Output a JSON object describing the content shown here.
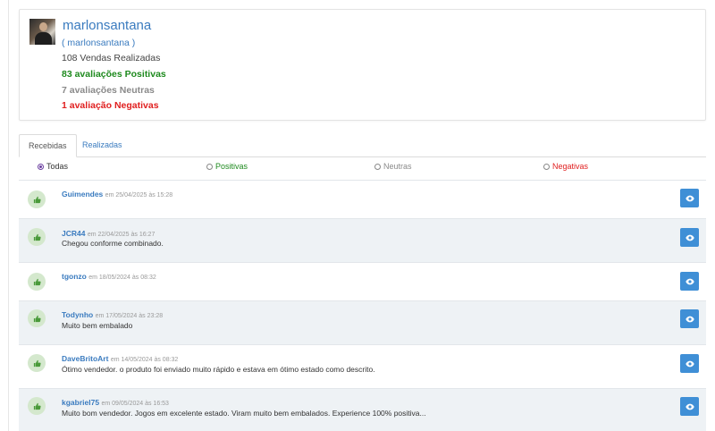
{
  "profile": {
    "username": "marlonsantana",
    "username_sub": "( marlonsantana )",
    "sales": "108 Vendas Realizadas",
    "positive": "83 avaliações Positivas",
    "neutral": "7 avaliações Neutras",
    "negative": "1 avaliação Negativas"
  },
  "tabs": {
    "received": "Recebidas",
    "given": "Realizadas"
  },
  "filters": {
    "all": "Todas",
    "positive": "Positivas",
    "neutral": "Neutras",
    "negative": "Negativas"
  },
  "reviews": [
    {
      "buyer": "Guimendes",
      "date": "em 25/04/2025 às 15:28",
      "comment": ""
    },
    {
      "buyer": "JCR44",
      "date": "em 22/04/2025 às 16:27",
      "comment": "Chegou conforme combinado."
    },
    {
      "buyer": "tgonzo",
      "date": "em 18/05/2024 às 08:32",
      "comment": ""
    },
    {
      "buyer": "Todynho",
      "date": "em 17/05/2024 às 23:28",
      "comment": "Muito bem embalado"
    },
    {
      "buyer": "DaveBritoArt",
      "date": "em 14/05/2024 às 08:32",
      "comment": "Ótimo vendedor. o produto foi enviado muito rápido e estava em ótimo estado como descrito."
    },
    {
      "buyer": "kgabriel75",
      "date": "em 09/05/2024 às 16:53",
      "comment": "Muito bom vendedor. Jogos em excelente estado. Viram muito bem embalados. Experience 100% positiva..."
    }
  ],
  "colors": {
    "link": "#3a7bbf",
    "positive": "#1e8a1e",
    "neutral": "#8a8a8a",
    "negative": "#e02020",
    "button": "#3f8fd6"
  },
  "icons": {
    "review_type": "thumbs-up-icon",
    "details": "eye-icon"
  }
}
